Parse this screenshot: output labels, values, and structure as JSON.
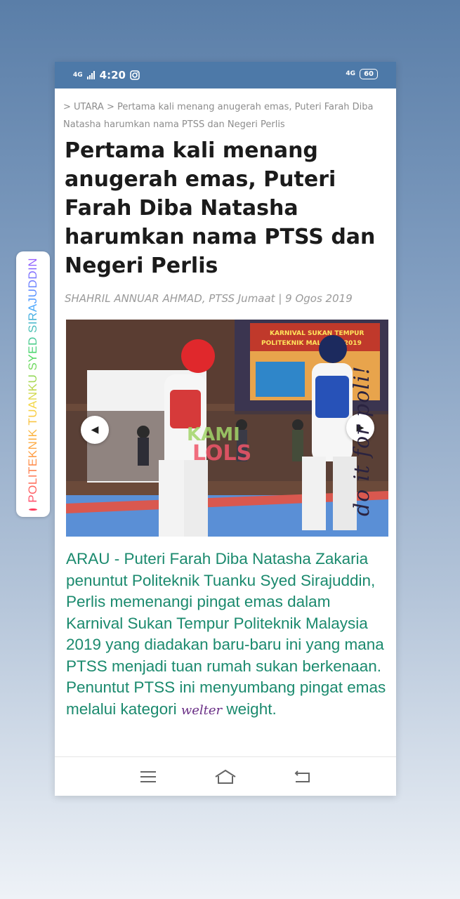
{
  "status_bar": {
    "time": "4:20",
    "network_left": "4G",
    "network_right": "4G",
    "battery": "60"
  },
  "breadcrumb": {
    "sep": ">",
    "section": "UTARA",
    "page": "Pertama kali menang anugerah emas, Puteri Farah Diba Natasha harumkan nama PTSS dan Negeri Perlis"
  },
  "article": {
    "title": "Pertama kali menang anugerah emas, Puteri Farah Diba Natasha harumkan nama PTSS dan Negeri Perlis",
    "byline": "SHAHRIL ANNUAR AHMAD, PTSS Jumaat | 9 Ogos 2019",
    "lead": "ARAU - Puteri Farah Diba Natasha Zakaria penuntut Politeknik Tuanku Syed Sirajuddin, Perlis memenangi pingat emas dalam Karnival Sukan Tempur Politeknik Malaysia 2019 yang diadakan baru-baru ini yang mana PTSS menjadi tuan rumah sukan berkenaan. Penuntut PTSS ini menyumbang pingat emas melalui kategori",
    "welter": "welter",
    "weight": "weight."
  },
  "photo": {
    "banner_line1": "KARNIVAL SUKAN TEMPUR",
    "banner_line2": "POLITEKNIK MALAYSIA 2019",
    "watermark_top": "KAMI",
    "watermark_bottom": "LOLS"
  },
  "sticker": {
    "label": "POLITEKNIK TUANKU SYED SIRAJUDDIN"
  },
  "handwriting": "do it for poli!",
  "colors": {
    "status_bar": "#4d79a8",
    "lead_text": "#1b8a6e",
    "title_text": "#1b1b1b"
  }
}
